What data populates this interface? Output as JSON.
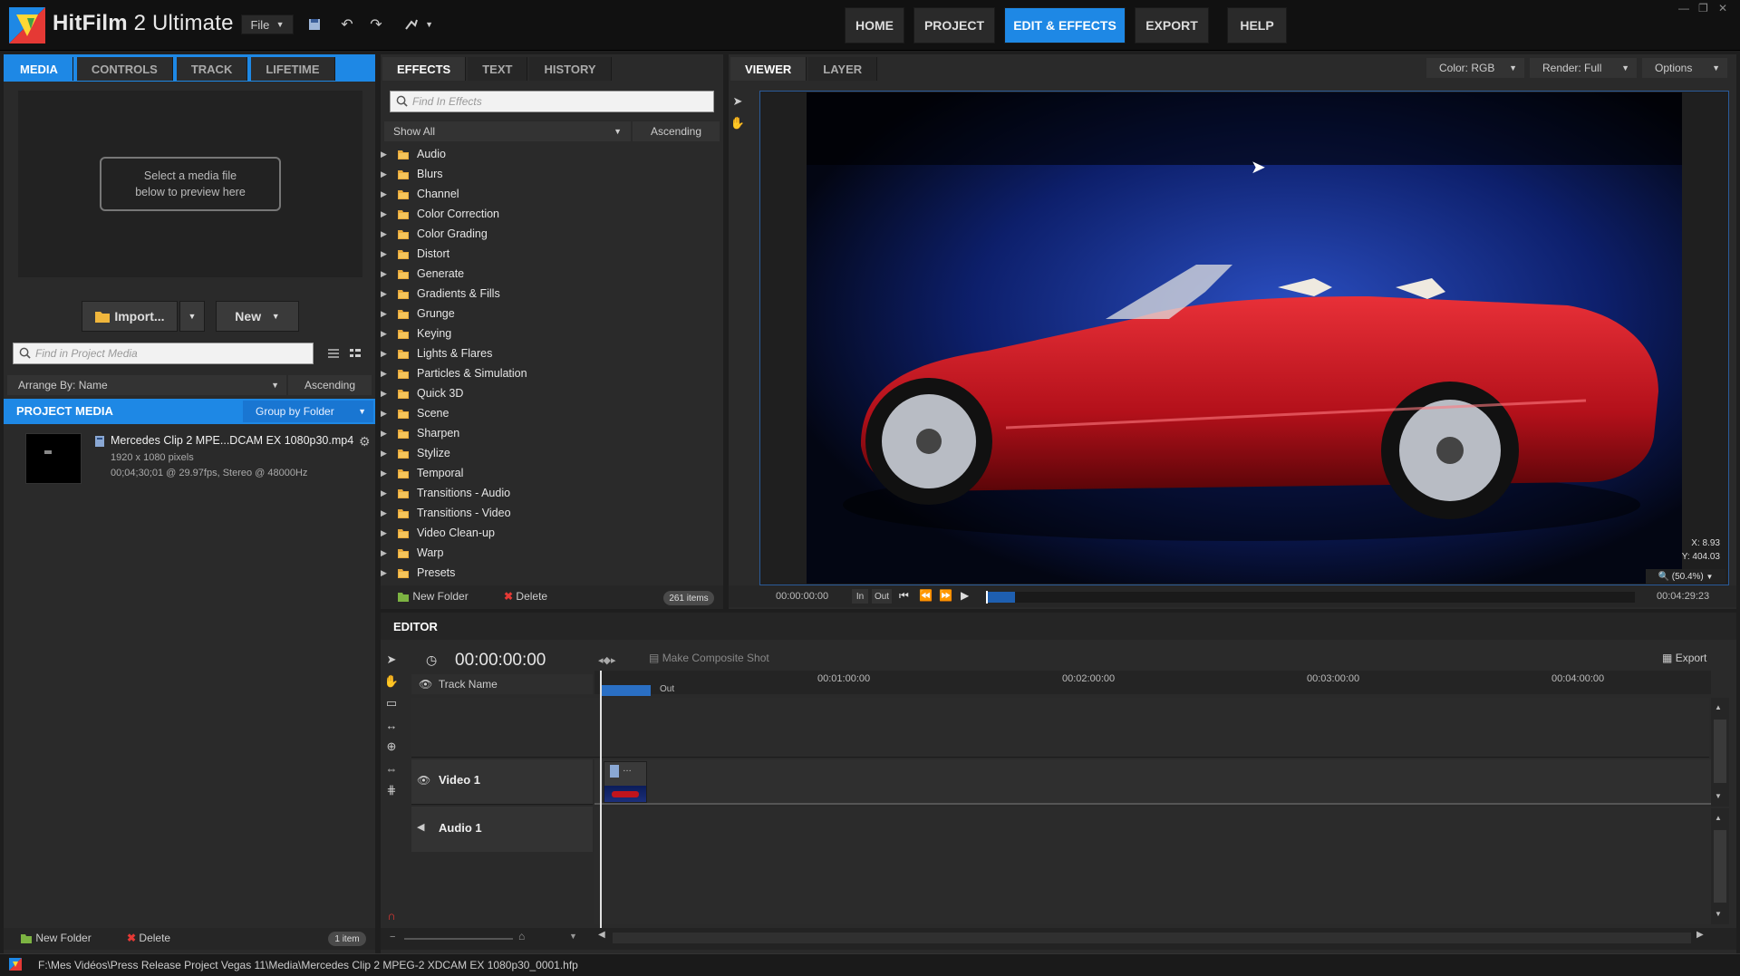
{
  "app": {
    "name_bold": "HitFilm",
    "name_rest": " 2 Ultimate",
    "file_menu": "File"
  },
  "nav": {
    "home": "HOME",
    "project": "PROJECT",
    "edit_effects": "EDIT & EFFECTS",
    "export": "EXPORT",
    "help": "HELP"
  },
  "left_tabs": {
    "media": "MEDIA",
    "controls": "CONTROLS",
    "track": "TRACK",
    "lifetime": "LIFETIME"
  },
  "preview": {
    "placeholder_line1": "Select a media file",
    "placeholder_line2": "below to preview here"
  },
  "media_buttons": {
    "import": "Import...",
    "new": "New"
  },
  "media_search": {
    "placeholder": "Find in Project Media"
  },
  "arrange": {
    "label": "Arrange By: Name",
    "order": "Ascending"
  },
  "project_media": {
    "title": "PROJECT MEDIA",
    "group": "Group by Folder"
  },
  "media_item": {
    "name": "Mercedes Clip 2 MPE...DCAM EX 1080p30.mp4",
    "dims": "1920 x 1080 pixels",
    "info": "00;04;30;01 @ 29.97fps, Stereo @ 48000Hz"
  },
  "media_footer": {
    "new_folder": "New Folder",
    "delete": "Delete",
    "count": "1 item"
  },
  "effects_tabs": {
    "effects": "EFFECTS",
    "text": "TEXT",
    "history": "HISTORY"
  },
  "effects_search": {
    "placeholder": "Find In Effects"
  },
  "effects_filter": {
    "show": "Show All",
    "order": "Ascending"
  },
  "effects": [
    "Audio",
    "Blurs",
    "Channel",
    "Color Correction",
    "Color Grading",
    "Distort",
    "Generate",
    "Gradients & Fills",
    "Grunge",
    "Keying",
    "Lights & Flares",
    "Particles & Simulation",
    "Quick 3D",
    "Scene",
    "Sharpen",
    "Stylize",
    "Temporal",
    "Transitions - Audio",
    "Transitions - Video",
    "Video Clean-up",
    "Warp",
    "Presets"
  ],
  "effects_footer": {
    "new_folder": "New Folder",
    "delete": "Delete",
    "count": "261 items"
  },
  "viewer_tabs": {
    "viewer": "VIEWER",
    "layer": "LAYER"
  },
  "viewer_opts": {
    "color": "Color: RGB",
    "render": "Render: Full",
    "options": "Options"
  },
  "viewer_coords": {
    "x_label": "X:",
    "x_value": "8.93",
    "y_label": "Y:",
    "y_value": "404.03",
    "zoom": "(50.4%)"
  },
  "transport": {
    "time_start": "00:00:00:00",
    "in": "In",
    "out": "Out",
    "time_end": "00:04:29:23"
  },
  "editor": {
    "title": "EDITOR",
    "timecode": "00:00:00:00",
    "composite": "Make Composite Shot",
    "export": "Export",
    "track_name": "Track Name",
    "out_marker": "Out"
  },
  "ruler": [
    "00:01:00:00",
    "00:02:00:00",
    "00:03:00:00",
    "00:04:00:00"
  ],
  "tracks": {
    "video": "Video 1",
    "audio": "Audio 1"
  },
  "status": {
    "path": "F:\\Mes Vidéos\\Press Release Project Vegas 11\\Media\\Mercedes Clip 2 MPEG-2 XDCAM EX 1080p30_0001.hfp"
  },
  "colors": {
    "accent": "#1e88e5",
    "car_red": "#c0141c",
    "viewer_bg": "#0a1a4a"
  }
}
